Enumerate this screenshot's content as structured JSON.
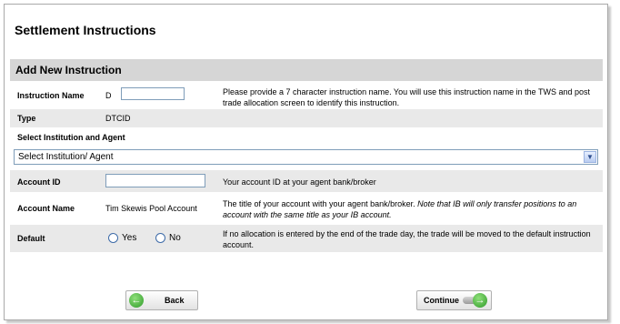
{
  "page": {
    "title": "Settlement Instructions",
    "section_title": "Add New Instruction"
  },
  "instruction_name": {
    "label": "Instruction Name",
    "prefix": "D",
    "value": "",
    "description": "Please provide a 7 character instruction name. You will use this instruction name in the TWS and post trade allocation screen to identify this instruction."
  },
  "type": {
    "label": "Type",
    "value": "DTCID"
  },
  "institution": {
    "label": "Select Institution and Agent",
    "selected": "Select Institution/ Agent"
  },
  "account_id": {
    "label": "Account ID",
    "value": "",
    "description": "Your account ID at your agent bank/broker"
  },
  "account_name": {
    "label": "Account Name",
    "value": "Tim Skewis Pool Account",
    "description_plain": "The title of your account with your agent bank/broker.",
    "description_italic": "Note that IB will only transfer positions to an account with the same title as your IB account."
  },
  "default": {
    "label": "Default",
    "option_yes": "Yes",
    "option_no": "No",
    "description": "If no allocation is entered by the end of the trade day, the trade will be moved to the default instruction account."
  },
  "buttons": {
    "back": "Back",
    "continue": "Continue"
  },
  "icons": {
    "back": "arrow-left-icon",
    "continue": "arrow-right-icon",
    "dropdown": "chevron-down-icon"
  }
}
